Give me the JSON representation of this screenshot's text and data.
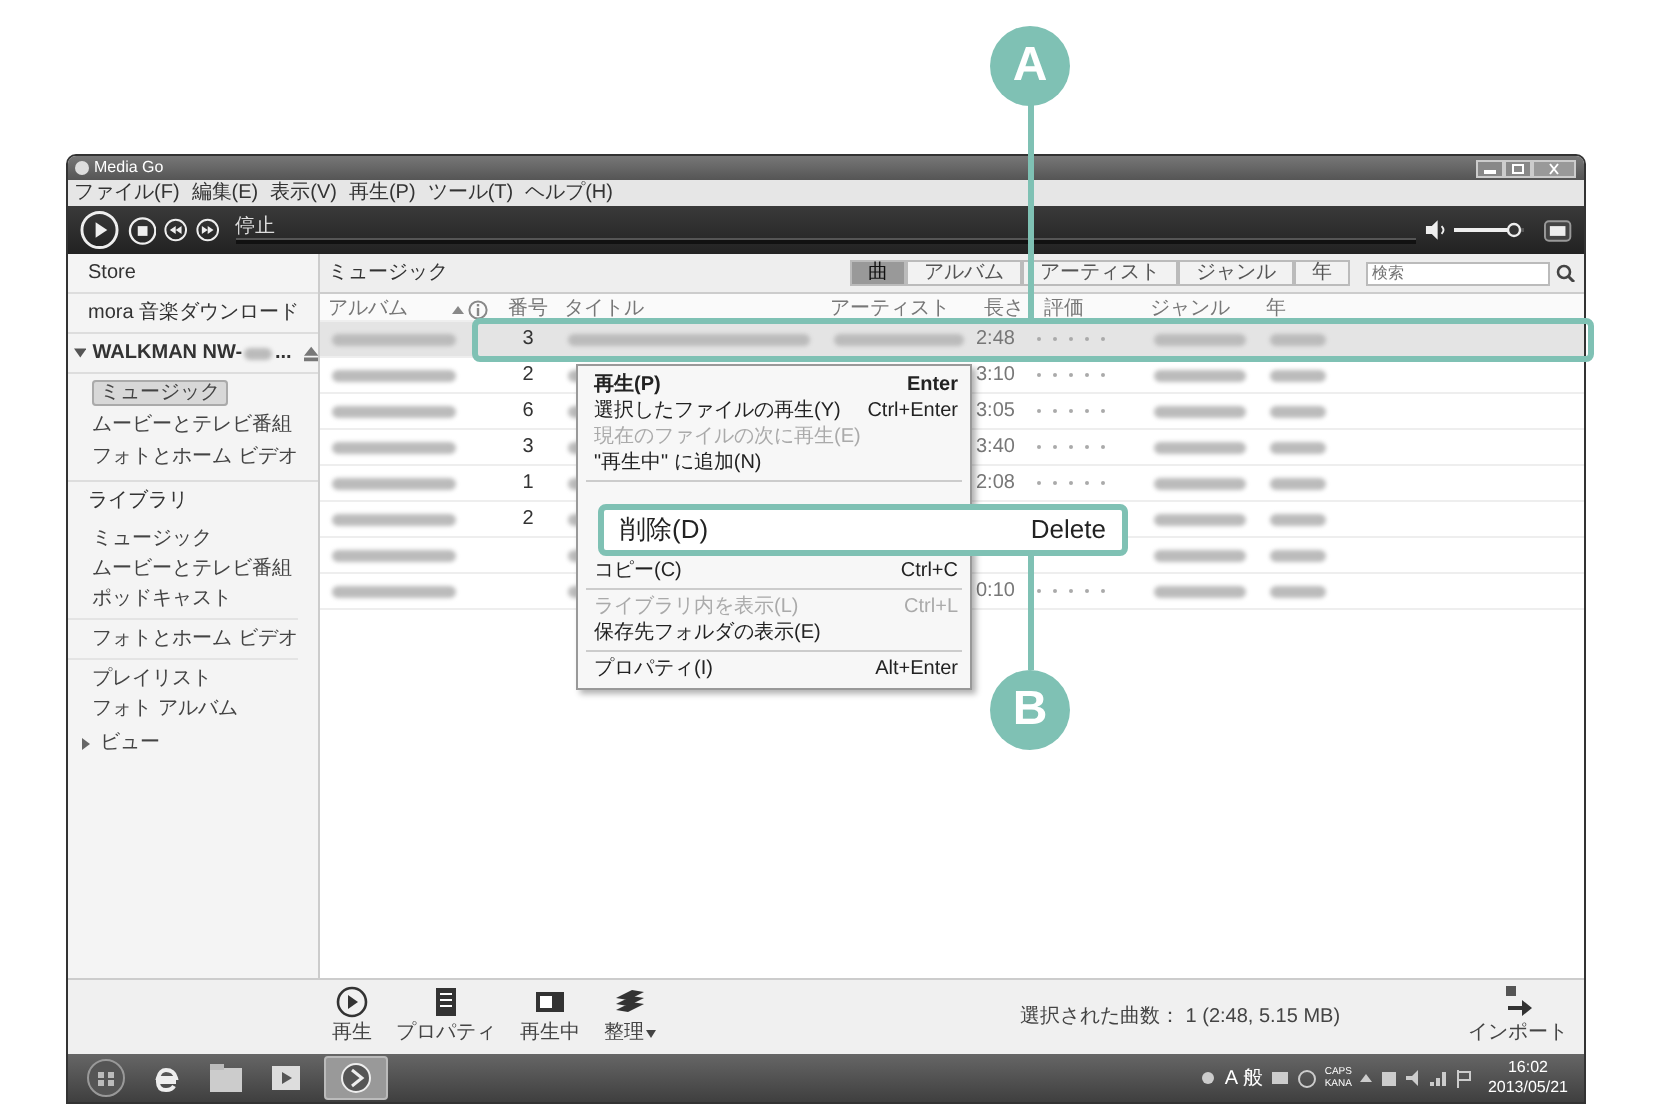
{
  "window": {
    "title": "Media Go"
  },
  "menu_bar": [
    "ファイル(F)",
    "編集(E)",
    "表示(V)",
    "再生(P)",
    "ツール(T)",
    "ヘルプ(H)"
  ],
  "player": {
    "status": "停止",
    "volume": {
      "level": 0.85
    }
  },
  "sidebar": {
    "top_items": [
      "Store",
      "mora 音楽ダウンロード"
    ],
    "device": {
      "name": "WALKMAN NW-",
      "suffix": "...",
      "expanded": true,
      "items": [
        {
          "label": "ミュージック",
          "selected": true
        },
        {
          "label": "ムービーとテレビ番組",
          "selected": false
        },
        {
          "label": "フォトとホーム ビデオ",
          "selected": false
        }
      ]
    },
    "library": {
      "label": "ライブラリ",
      "groups": [
        [
          "ミュージック",
          "ムービーとテレビ番組",
          "ポッドキャスト"
        ],
        [
          "フォトとホーム ビデオ"
        ],
        [
          "プレイリスト",
          "フォト アルバム"
        ]
      ],
      "view": {
        "label": "ビュー",
        "expanded": false
      }
    }
  },
  "content": {
    "title": "ミュージック",
    "view_tabs": [
      {
        "label": "曲",
        "selected": true
      },
      {
        "label": "アルバム",
        "selected": false
      },
      {
        "label": "アーティスト",
        "selected": false
      },
      {
        "label": "ジャンル",
        "selected": false
      },
      {
        "label": "年",
        "selected": false
      }
    ],
    "search": {
      "placeholder": "検索"
    },
    "columns": [
      "アルバム",
      "番号",
      "タイトル",
      "アーティスト",
      "長さ",
      "評価",
      "ジャンル",
      "年"
    ],
    "rows": [
      {
        "track": "3",
        "length": "2:48",
        "selected": true
      },
      {
        "track": "2",
        "length": "3:10",
        "selected": false
      },
      {
        "track": "6",
        "length": "3:05",
        "selected": false
      },
      {
        "track": "3",
        "length": "3:40",
        "selected": false
      },
      {
        "track": "1",
        "length": "2:08",
        "selected": false
      },
      {
        "track": "2",
        "length": "",
        "selected": false
      },
      {
        "track": "",
        "length": "",
        "selected": false
      },
      {
        "track": "",
        "length": "0:10",
        "selected": false
      }
    ],
    "context_menu": [
      {
        "kind": "item",
        "label": "再生(P)",
        "shortcut": "Enter",
        "bold": true,
        "disabled": false
      },
      {
        "kind": "item",
        "label": "選択したファイルの再生(Y)",
        "shortcut": "Ctrl+Enter",
        "bold": false,
        "disabled": false
      },
      {
        "kind": "item",
        "label": "現在のファイルの次に再生(E)",
        "bold": false,
        "disabled": true
      },
      {
        "kind": "item",
        "label": "\"再生中\" に追加(N)",
        "bold": false,
        "disabled": false
      },
      {
        "kind": "separator"
      },
      {
        "kind": "callout",
        "label": "削除(D)",
        "shortcut": "Delete"
      },
      {
        "kind": "item",
        "label": "コピー(C)",
        "shortcut": "Ctrl+C",
        "bold": false,
        "disabled": false
      },
      {
        "kind": "separator"
      },
      {
        "kind": "item",
        "label": "ライブラリ内を表示(L)",
        "shortcut": "Ctrl+L",
        "bold": false,
        "disabled": true
      },
      {
        "kind": "item",
        "label": "保存先フォルダの表示(E)",
        "bold": false,
        "disabled": false
      },
      {
        "kind": "separator"
      },
      {
        "kind": "item",
        "label": "プロパティ(I)",
        "shortcut": "Alt+Enter",
        "bold": false,
        "disabled": false
      }
    ]
  },
  "toolbar": [
    {
      "kind": "play",
      "label": "再生"
    },
    {
      "kind": "properties",
      "label": "プロパティ"
    },
    {
      "kind": "now_playing",
      "label": "再生中"
    },
    {
      "kind": "organize",
      "label": "整理",
      "dropdown": true
    }
  ],
  "status": "選択された曲数： 1 (2:48, 5.15 MB)",
  "import": {
    "label": "インポート"
  },
  "taskbar": {
    "ime": "A 般",
    "caps": "CAPS",
    "kana": "KANA",
    "time": "16:02",
    "date": "2013/05/21"
  },
  "callouts": [
    {
      "label": "A"
    },
    {
      "label": "B"
    }
  ]
}
